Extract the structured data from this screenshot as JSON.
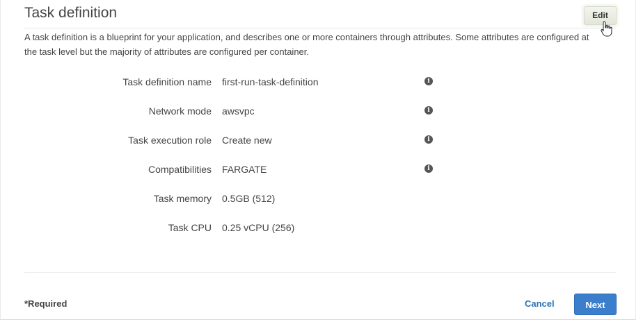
{
  "section": {
    "title": "Task definition",
    "edit_label": "Edit",
    "description": "A task definition is a blueprint for your application, and describes one or more containers through attributes. Some attributes are configured at the task level but the majority of attributes are configured per container."
  },
  "fields": [
    {
      "label": "Task definition name",
      "value": "first-run-task-definition",
      "info_icon": "info-icon"
    },
    {
      "label": "Network mode",
      "value": "awsvpc",
      "info_icon": "info-icon"
    },
    {
      "label": "Task execution role",
      "value": "Create new",
      "info_icon": "info-icon"
    },
    {
      "label": "Compatibilities",
      "value": "FARGATE",
      "info_icon": "info-icon"
    },
    {
      "label": "Task memory",
      "value": "0.5GB (512)"
    },
    {
      "label": "Task CPU",
      "value": "0.25 vCPU (256)"
    }
  ],
  "footer": {
    "required_label": "*Required",
    "cancel_label": "Cancel",
    "next_label": "Next"
  },
  "colors": {
    "primary_button": "#3b7fcc",
    "link": "#2b73b7",
    "text": "#444444"
  }
}
